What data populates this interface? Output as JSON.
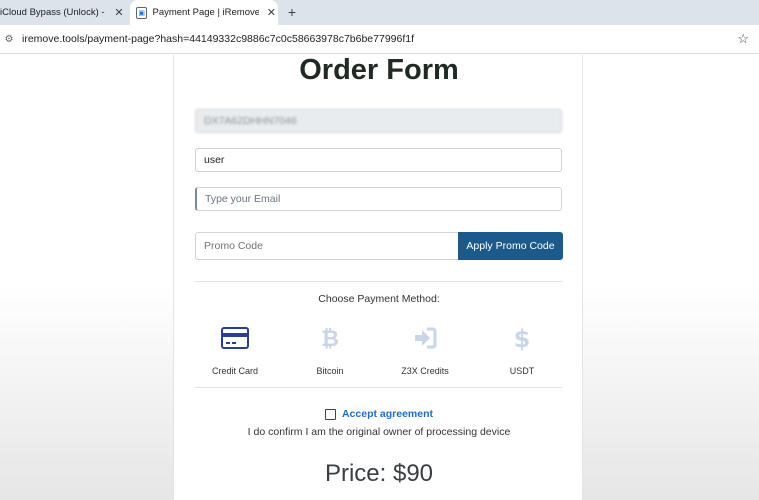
{
  "browser": {
    "tabs": [
      {
        "title": "iCloud Bypass (Unlock) - iRem",
        "active": false
      },
      {
        "title": "Payment Page | iRemove.Tools",
        "active": true
      }
    ],
    "new_tab_symbol": "+",
    "url": "iremove.tools/payment-page?hash=44149332c9886c7c0c58663978c7b6be77996f1f"
  },
  "form": {
    "heading": "Order Form",
    "serial_value": "DX7A62DHHN7046",
    "name_value": "user",
    "email_placeholder": "Type your Email",
    "promo_placeholder": "Promo Code",
    "promo_button": "Apply Promo Code",
    "choose_label": "Choose Payment Method:",
    "methods": [
      {
        "label": "Credit Card",
        "icon": "credit-card-icon",
        "color": "#2c3e8f"
      },
      {
        "label": "Bitcoin",
        "icon": "bitcoin-icon",
        "color": "#c9d6e8"
      },
      {
        "label": "Z3X Credits",
        "icon": "sign-in-icon",
        "color": "#c9d6e8"
      },
      {
        "label": "USDT",
        "icon": "dollar-icon",
        "color": "#c9d6e8"
      }
    ],
    "agreement_link": "Accept agreement",
    "agreement_text": "I do confirm I am the original owner of processing device",
    "price": "Price: $90"
  },
  "colors": {
    "accent": "#1c5a8b",
    "link": "#1c6fc4"
  }
}
